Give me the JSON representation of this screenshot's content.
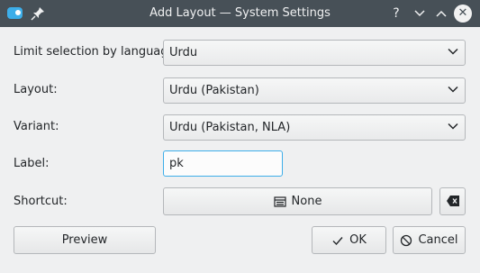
{
  "window": {
    "title": "Add Layout — System Settings",
    "app_icon": "settings-toggle-icon",
    "pin_icon": "pin-icon",
    "help_glyph": "?",
    "min_glyph": "⌄",
    "max_glyph": "⌃",
    "close_glyph": "✕"
  },
  "form": {
    "language_label": "Limit selection by language:",
    "language_value": "Urdu",
    "layout_label": "Layout:",
    "layout_value": "Urdu (Pakistan)",
    "variant_label": "Variant:",
    "variant_value": "Urdu (Pakistan, NLA)",
    "label_label": "Label:",
    "label_value": "pk",
    "shortcut_label": "Shortcut:",
    "shortcut_value": "None"
  },
  "buttons": {
    "preview": "Preview",
    "ok": "OK",
    "cancel": "Cancel"
  },
  "colors": {
    "titlebar": "#475057",
    "accent": "#3daee9",
    "background": "#eff0f1"
  }
}
